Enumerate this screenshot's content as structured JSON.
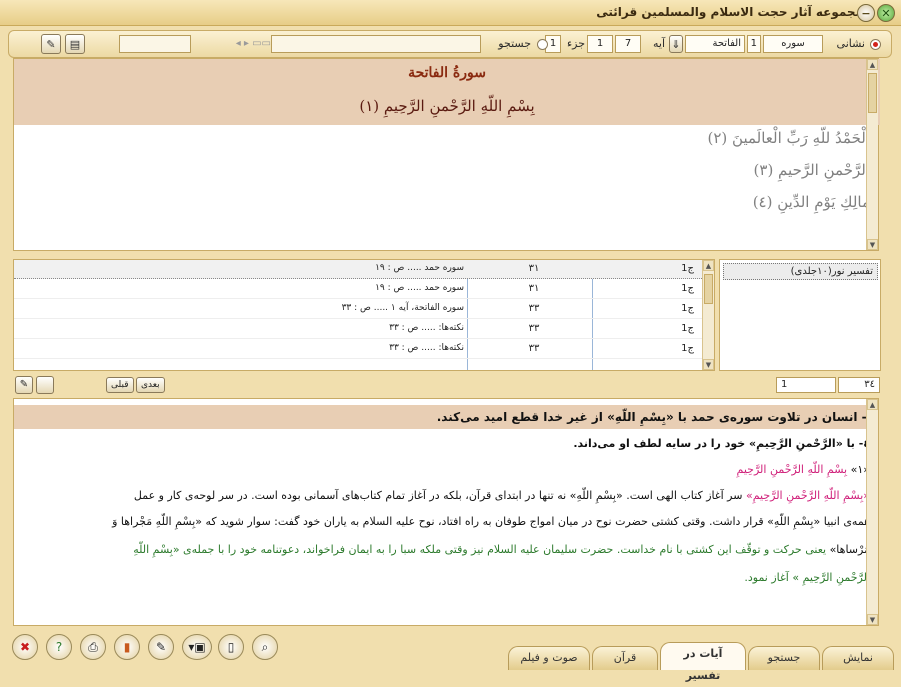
{
  "window": {
    "title": "مجموعه آثار حجت الاسلام والمسلمین قرائتی"
  },
  "toolbar": {
    "display_label": "نشانی",
    "sura_label": "سوره",
    "sura_num": "1",
    "sura_name": "الفاتحة",
    "aya_label": "آیه",
    "aya_total": "7",
    "aya_num": "1",
    "juz_label": "جزء",
    "juz_num": "1",
    "search_label": "جستجو",
    "search_value": ""
  },
  "quran": {
    "sura_title": "سورةُ الفاتحة",
    "basmala": "بِسْمِ اللّهِ الرَّحْمنِ الرَّحِيمِ (١)",
    "verses": [
      "اَلْحَمْدُ للّهِ رَبِّ الْعالَمينَ (٢)",
      "الرَّحْمنِ الرَّحيمِ (٣)",
      "مالِكِ يَوْمِ الدِّينِ (٤)"
    ]
  },
  "results": {
    "rows": [
      {
        "vol": "ج1",
        "page": "٣١",
        "text": "سوره حمد ..... ص : ١٩"
      },
      {
        "vol": "ج1",
        "page": "٣١",
        "text": "سوره حمد ..... ص : ١٩"
      },
      {
        "vol": "ج1",
        "page": "٣٣",
        "text": "سوره الفاتحة، آيه ١ ..... ص : ٣٣"
      },
      {
        "vol": "ج1",
        "page": "٣٣",
        "text": "نكته‌ها: ..... ص : ٣٣"
      },
      {
        "vol": "ج1",
        "page": "٣٣",
        "text": "نكته‌ها: ..... ص : ٣٣"
      }
    ]
  },
  "books": {
    "items": [
      "تفسیر نور(١٠جلدى)"
    ]
  },
  "nav": {
    "next_label": "بعدی",
    "prev_label": "قبلی",
    "page_field": "1",
    "total_field": "٣٤"
  },
  "text": {
    "heading": "١- انسان در تلاوت سوره‌ى حمد با «بِسْمِ اللّهِ» از غير خدا قطع اميد مى‌كند.",
    "line2": "٤- با «الرَّحْمنِ الرَّحِيمِ» خود را در سايه لطف او مى‌داند.",
    "line3_num": "«١»",
    "line3_basmala": "بِسْمِ اللّهِ الرَّحْمنِ الرَّحِيمِ",
    "p1_q": "«بِسْمِ اللّهِ الرَّحْمنِ الرَّحِيمِ»",
    "p1_rest": " سر آغاز كتاب الهى است. «بِسْمِ اللّهِ» نه تنها در ابتداى قرآن، بلكه در آغاز تمام كتاب‌هاى آسمانى بوده است. در سر لوحه‌ى كار و عمل",
    "p2": "همه‌ى انبيا «بِسْمِ اللّهِ» قرار داشت. وقتى كشتى حضرت نوح در ميان امواج طوفان به راه افتاد، نوح عليه السلام به ياران خود گفت: سوار شويد كه «بِسْمِ اللّهِ مَجْراها وَ",
    "p3_q": "مُرْساها»",
    "p3_rest": " يعنى حركت و توقّف اين كشتى با نام خداست. حضرت سليمان عليه السلام نيز وقتى ملكه سبا را به ايمان فراخواند، دعوتنامه خود را با جمله‌ى «بِسْمِ اللّهِ",
    "p4": "الرَّحْمنِ الرَّحِيمِ » آغاز نمود."
  },
  "tabs": [
    {
      "label": "نمایش"
    },
    {
      "label": "جستجو"
    },
    {
      "label": "آیات در تفسیر"
    },
    {
      "label": "قرآن"
    },
    {
      "label": "صوت و فیلم"
    }
  ],
  "icons": {
    "close": "close-icon",
    "help": "help-icon",
    "print": "print-icon",
    "book": "book-icon",
    "edit": "edit-icon",
    "export": "export-icon",
    "page": "page-icon",
    "search": "search-icon"
  },
  "colors": {
    "accent": "#d0207a",
    "green_text": "#2c7a2c",
    "header_bg": "#e8ceb4"
  }
}
